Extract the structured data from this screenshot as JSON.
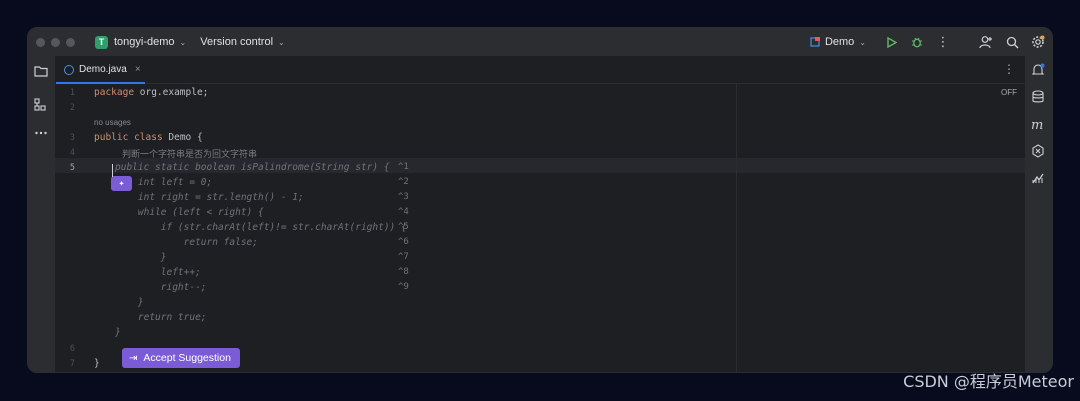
{
  "titlebar": {
    "project_badge": "T",
    "project_name": "tongyi-demo",
    "version_control": "Version control",
    "run_config": "Demo"
  },
  "tabs": [
    {
      "label": "Demo.java",
      "close": "×"
    }
  ],
  "editor": {
    "off_label": "OFF",
    "line_numbers": [
      "1",
      "2",
      "3",
      "4",
      "5",
      "6",
      "7"
    ],
    "line1_keyword": "package",
    "line1_rest": " org.example;",
    "usages_hint": "no usages",
    "line3_kw1": "public",
    "line3_kw2": "class",
    "line3_rest": " Demo {",
    "comment": "判断一个字符串是否为回文字符串",
    "suggestion_lines": [
      {
        "text": "public static boolean isPalindrome(String str) {",
        "shortcut": "^1"
      },
      {
        "text": "    int left = 0;",
        "shortcut": "^2"
      },
      {
        "text": "    int right = str.length() - 1;",
        "shortcut": "^3"
      },
      {
        "text": "    while (left < right) {",
        "shortcut": "^4"
      },
      {
        "text": "        if (str.charAt(left)!= str.charAt(right)) {",
        "shortcut": "^5"
      },
      {
        "text": "            return false;",
        "shortcut": "^6"
      },
      {
        "text": "        }",
        "shortcut": "^7"
      },
      {
        "text": "        left++;",
        "shortcut": "^8"
      },
      {
        "text": "        right--;",
        "shortcut": "^9"
      },
      {
        "text": "    }",
        "shortcut": ""
      },
      {
        "text": "    return true;",
        "shortcut": ""
      },
      {
        "text": "}",
        "shortcut": ""
      }
    ],
    "closing_brace": "}",
    "accept_suggestion": "Accept Suggestion",
    "ai_badge": "✦"
  },
  "watermark": "CSDN @程序员Meteor",
  "colors": {
    "accent": "#3574f0",
    "ai_purple": "#7c5cd6",
    "keyword": "#cf8e6d",
    "project_badge": "#2f9e6b"
  }
}
